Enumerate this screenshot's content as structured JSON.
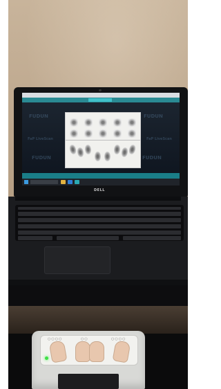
{
  "laptop": {
    "brand_text": "DELL",
    "screen": {
      "app_title": "",
      "background_brand_text": "FUDUN",
      "background_sub_text": "FaP LiveScan",
      "taskbar_clock": ""
    }
  },
  "scanner": {
    "status_led_color": "#3fe047"
  },
  "colors": {
    "wall": "#bca68c",
    "app_accent": "#2a8a93",
    "laptop_body": "#1b1c1f",
    "scanner_body": "#d8d9d6"
  }
}
